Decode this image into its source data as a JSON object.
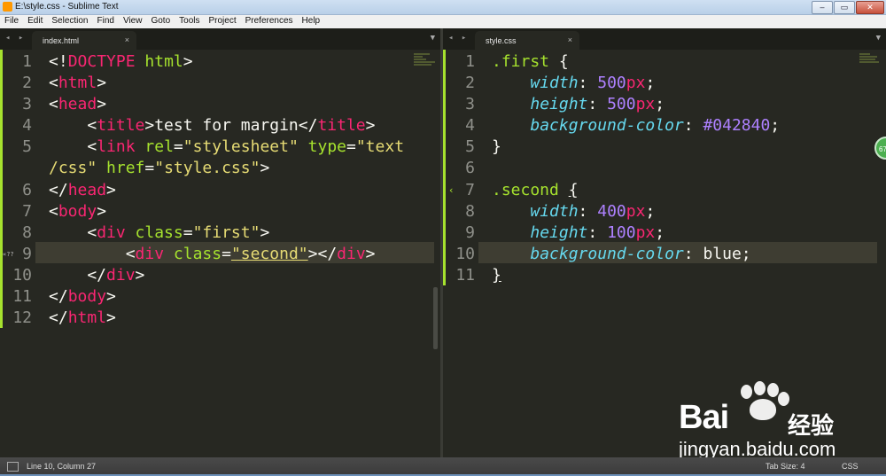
{
  "window": {
    "title": "E:\\style.css - Sublime Text",
    "minimize_glyph": "–",
    "restore_glyph": "▭",
    "close_glyph": "✕"
  },
  "menu": [
    "File",
    "Edit",
    "Selection",
    "Find",
    "View",
    "Goto",
    "Tools",
    "Project",
    "Preferences",
    "Help"
  ],
  "tabs": {
    "left": {
      "label": "index.html",
      "close": "×"
    },
    "right": {
      "label": "style.css",
      "close": "×"
    },
    "nav_glyph": "◂ ▸",
    "dropdown_glyph": "▼"
  },
  "left_editor": {
    "line_numbers": [
      "1",
      "2",
      "3",
      "4",
      "5",
      "",
      "6",
      "7",
      "8",
      "9",
      "10",
      "11",
      "12"
    ],
    "gutter_marker_9": "«??",
    "current_line": 9
  },
  "right_editor": {
    "line_numbers": [
      "1",
      "2",
      "3",
      "4",
      "5",
      "6",
      "7",
      "8",
      "9",
      "10",
      "11"
    ],
    "current_line": 10,
    "fold_marker": "‹",
    "rule1": {
      "selector": ".first",
      "width_value": "500",
      "height_value": "500",
      "bg_value": "#042840",
      "unit": "px"
    },
    "rule2": {
      "selector": ".second",
      "width_value": "400",
      "height_value": "100",
      "bg_value": "blue",
      "unit": "px"
    }
  },
  "side_badge": "67",
  "watermark": {
    "brand_text": "Bai",
    "brand_cn": "经验",
    "site": "jingyan.baidu.com"
  },
  "status": {
    "position": "Line 10, Column 27",
    "tab_size": "Tab Size: 4",
    "syntax": "CSS"
  },
  "colors": {
    "accent_green": "#a6e22e",
    "tag_pink": "#f92672",
    "string_yellow": "#e6db74",
    "prop_cyan": "#66d9ef",
    "num_purple": "#ae81ff",
    "editor_bg": "#272822"
  }
}
